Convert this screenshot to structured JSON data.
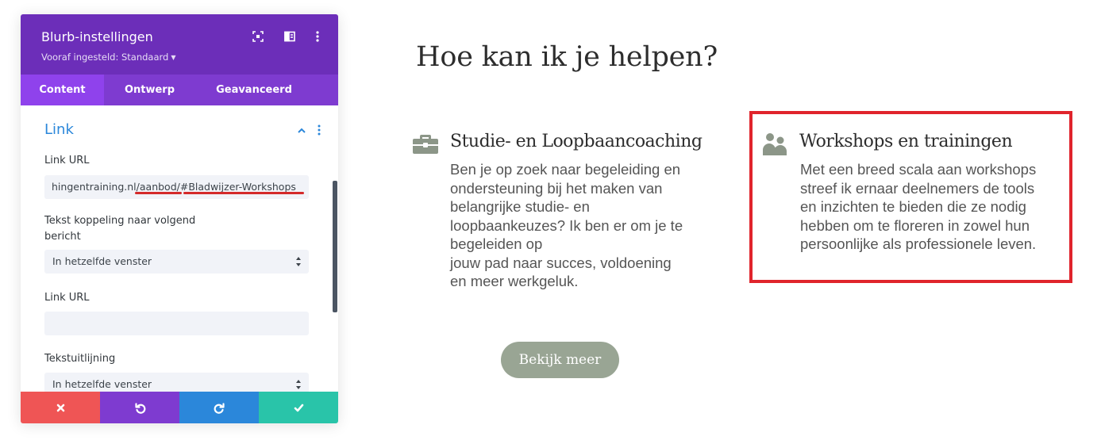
{
  "settings_panel": {
    "title": "Blurb-instellingen",
    "preset": "Vooraf ingesteld: Standaard",
    "header_icons": [
      "expand-icon",
      "split-view-icon",
      "more-vertical-icon"
    ],
    "tabs": [
      {
        "label": "Content",
        "active": true
      },
      {
        "label": "Ontwerp",
        "active": false
      },
      {
        "label": "Geavanceerd",
        "active": false
      }
    ],
    "section": {
      "title": "Link",
      "expanded": true
    },
    "fields": {
      "link_url_label": "Link URL",
      "link_url_value": "hingentraining.nl/aanbod/#Bladwijzer-Workshops",
      "target_label": "Tekst koppeling naar volgend bericht",
      "target_value": "In hetzelfde venster",
      "link_url2_label": "Link URL",
      "link_url2_value": "",
      "alignment_label": "Tekstuitlijning",
      "alignment_value": "In hetzelfde venster"
    },
    "footer_buttons": [
      {
        "name": "cancel",
        "icon": "close-icon",
        "color": "#ef5555"
      },
      {
        "name": "undo",
        "icon": "undo-icon",
        "color": "#7e3bd0"
      },
      {
        "name": "redo",
        "icon": "redo-icon",
        "color": "#2b87da"
      },
      {
        "name": "save",
        "icon": "check-icon",
        "color": "#29c4a9"
      }
    ]
  },
  "page": {
    "heading": "Hoe kan ik je helpen?",
    "blurbs": [
      {
        "icon": "briefcase-icon",
        "title": "Studie- en Loopbaancoaching",
        "lines": [
          "Ben je op zoek naar begeleiding en",
          "ondersteuning bij het maken van",
          "belangrijke studie- en",
          "loopbaankeuzes? Ik ben er om je te",
          "begeleiden op",
          "jouw pad naar succes, voldoening",
          "en meer werkgeluk."
        ]
      },
      {
        "icon": "users-icon",
        "title": "Workshops en trainingen",
        "lines": [
          "Met een breed scala aan workshops",
          "streef ik ernaar deelnemers de tools",
          "en inzichten te bieden die ze nodig",
          "hebben om te floreren in zowel hun",
          "persoonlijke als professionele leven."
        ]
      }
    ],
    "cta_label": "Bekijk meer"
  },
  "colors": {
    "header_purple": "#6c2eb9",
    "tab_purple": "#7e3bd0",
    "active_tab": "#8f42ec",
    "section_blue": "#2b87da",
    "highlight_red": "#e0242c",
    "underline_red": "#d42a2a",
    "icon_sage": "#8c9688",
    "cta_background": "#99a594"
  }
}
